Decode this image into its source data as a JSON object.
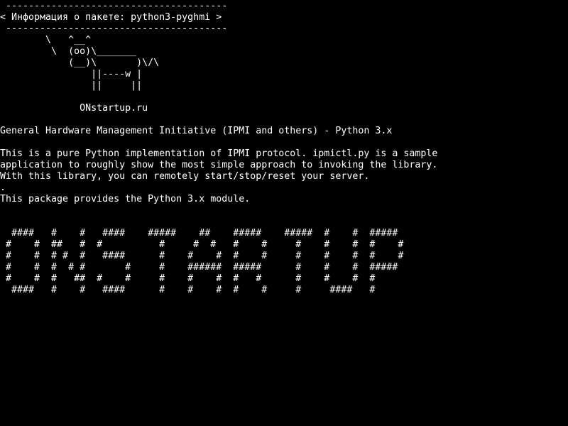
{
  "screen": {
    "background": "#000000",
    "foreground": "#ffffff"
  },
  "bubble": {
    "top_border": " ---------------------------------------",
    "text": "< Информация о пакете: python3-pyghmi >",
    "bottom_border": " ---------------------------------------"
  },
  "cow_art": [
    "        \\   ^__^",
    "         \\  (oo)\\_______",
    "            (__)\\       )\\/\\",
    "                ||----w |",
    "                ||     ||"
  ],
  "site": "              ONstartup.ru",
  "package": {
    "summary": "General Hardware Management Initiative (IPMI and others) - Python 3.x",
    "description": [
      "This is a pure Python implementation of IPMI protocol. ipmictl.py is a sample",
      "application to roughly show the most simple approach to invoking the library.",
      "With this library, you can remotely start/stop/reset your server.",
      ".",
      "This package provides the Python 3.x module."
    ]
  },
  "banner_art": [
    "  ####   #    #   ####    #####    ##    #####    #####  #    #  #####",
    " #    #  ##   #  #          #     #  #   #    #     #    #    #  #    #",
    " #    #  # #  #   ####      #    #    #  #    #     #    #    #  #    #",
    " #    #  #  # #       #     #    ######  #####      #    #    #  #####",
    " #    #  #   ##  #    #     #    #    #  #   #      #    #    #  #",
    "  ####   #    #   ####      #    #    #  #    #     #     ####   #"
  ]
}
